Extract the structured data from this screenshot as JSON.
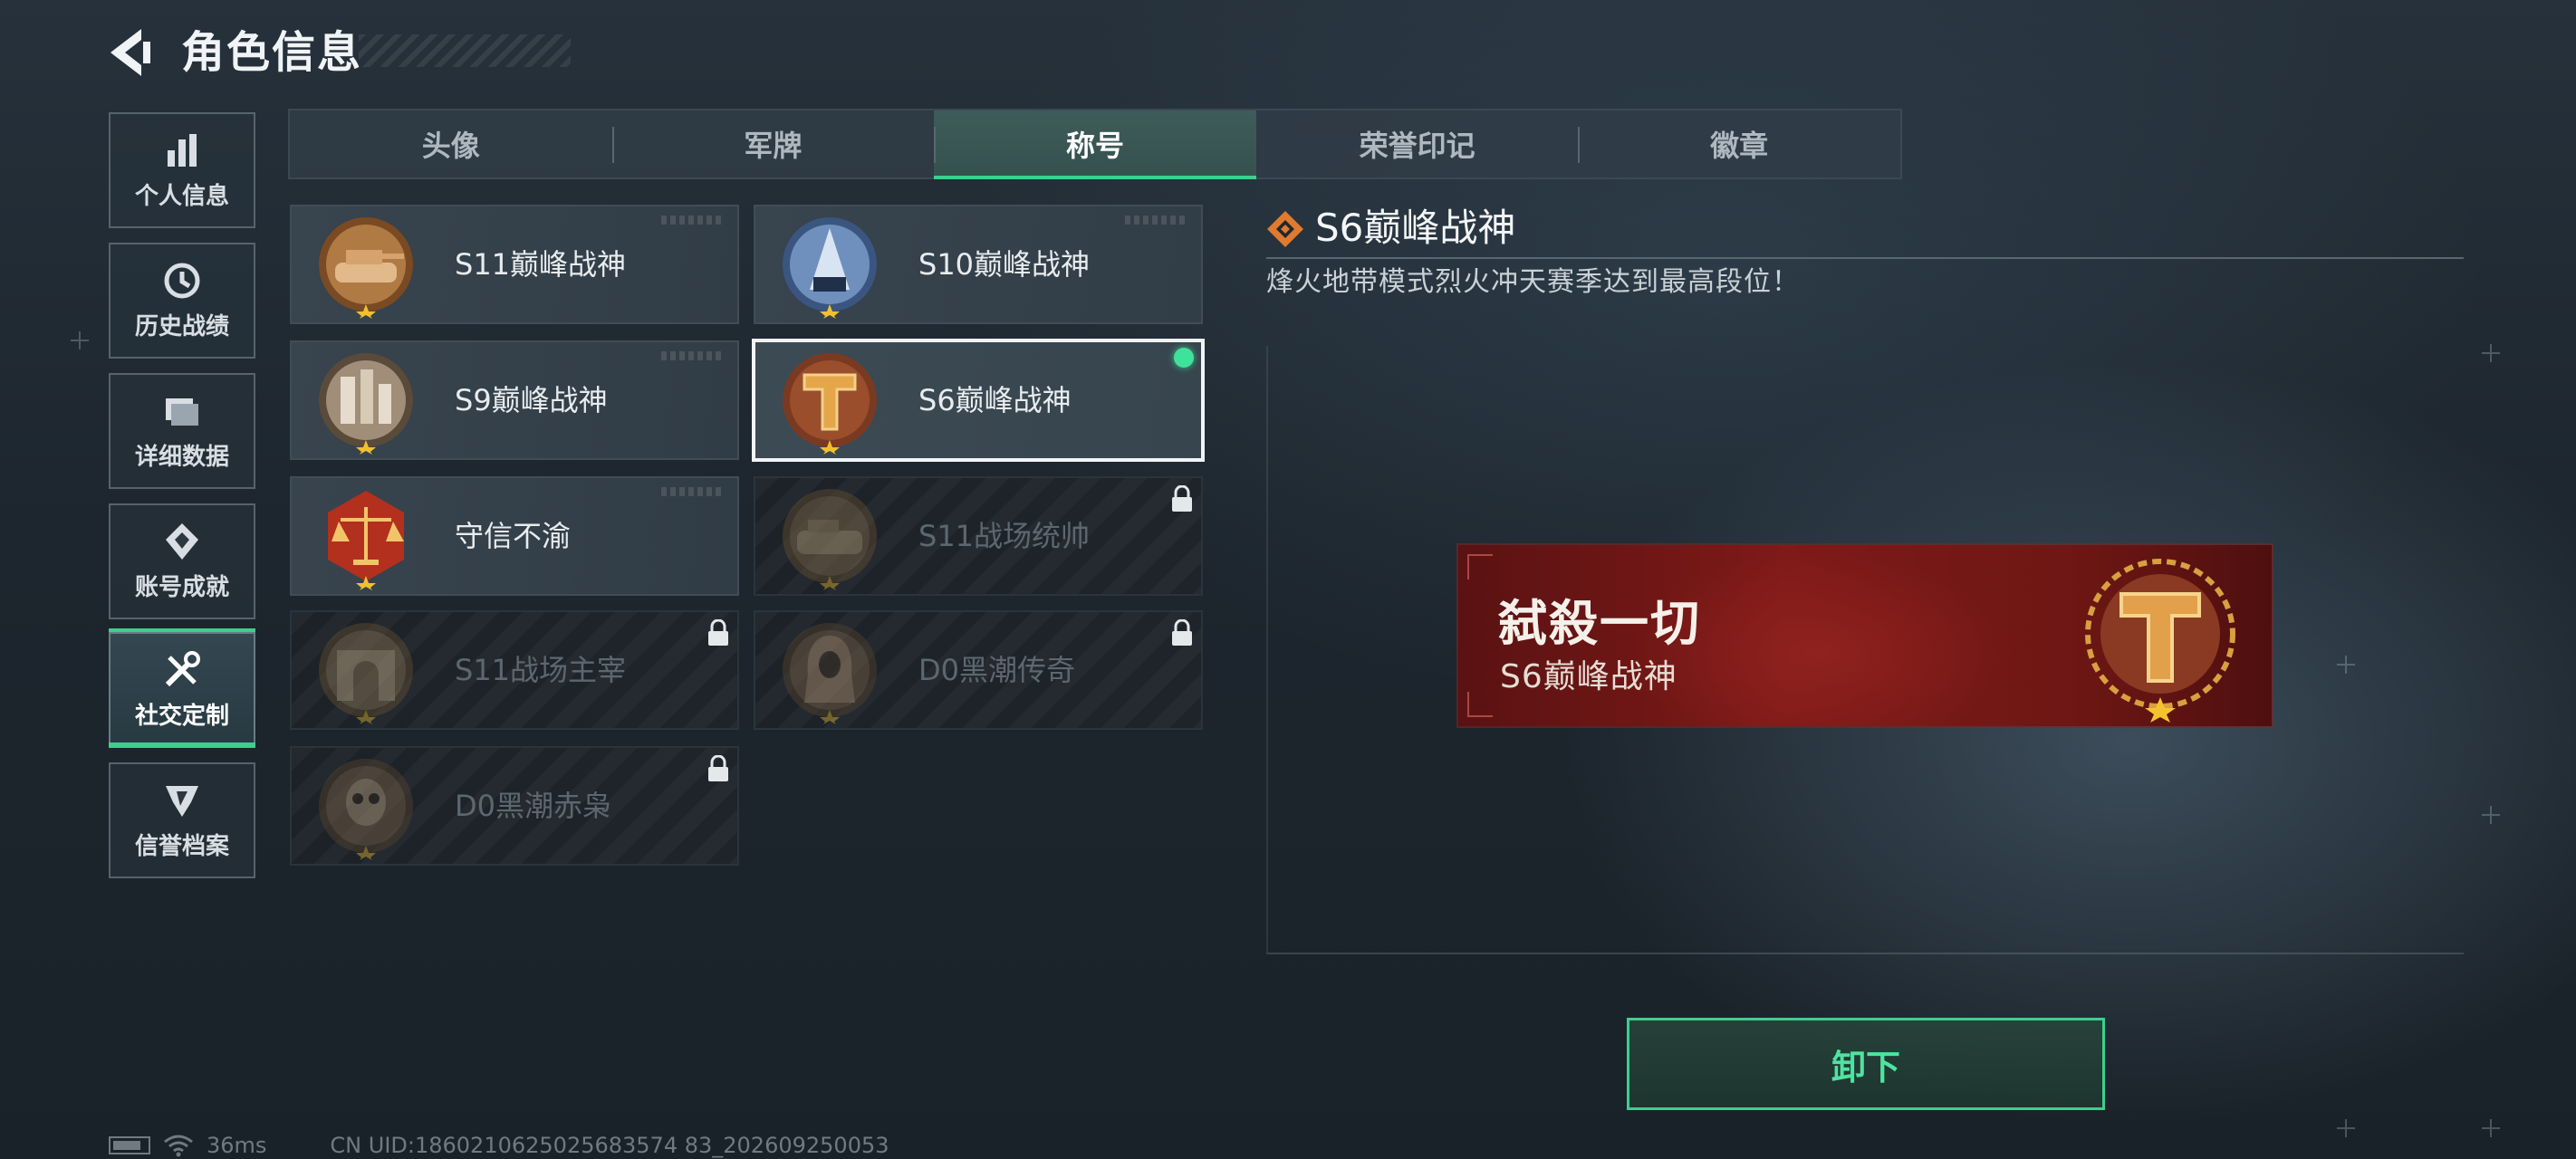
{
  "header": {
    "title": "角色信息"
  },
  "sidebar": {
    "items": [
      {
        "label": "个人信息",
        "icon": "bar-chart-icon",
        "active": false
      },
      {
        "label": "历史战绩",
        "icon": "history-clock-icon",
        "active": false
      },
      {
        "label": "详细数据",
        "icon": "folder-data-icon",
        "active": false
      },
      {
        "label": "账号成就",
        "icon": "achievement-diamond-icon",
        "active": false
      },
      {
        "label": "社交定制",
        "icon": "tools-wrench-icon",
        "active": true
      },
      {
        "label": "信誉档案",
        "icon": "credit-shield-icon",
        "active": false
      }
    ]
  },
  "tabs": [
    {
      "label": "头像",
      "active": false
    },
    {
      "label": "军牌",
      "active": false
    },
    {
      "label": "称号",
      "active": true
    },
    {
      "label": "荣誉印记",
      "active": false
    },
    {
      "label": "徽章",
      "active": false
    }
  ],
  "titles": [
    {
      "label": "S11巅峰战神",
      "medal": "tank-medal-icon",
      "locked": false,
      "selected": false
    },
    {
      "label": "S10巅峰战神",
      "medal": "fortress-medal-icon",
      "locked": false,
      "selected": false
    },
    {
      "label": "S9巅峰战神",
      "medal": "ruins-medal-icon",
      "locked": false,
      "selected": false
    },
    {
      "label": "S6巅峰战神",
      "medal": "t-emblem-medal-icon",
      "locked": false,
      "selected": true
    },
    {
      "label": "守信不渝",
      "medal": "scales-medal-icon",
      "locked": false,
      "selected": false
    },
    {
      "label": "S11战场统帅",
      "medal": "apc-medal-icon",
      "locked": true,
      "selected": false
    },
    {
      "label": "S11战场主宰",
      "medal": "arch-medal-icon",
      "locked": true,
      "selected": false
    },
    {
      "label": "D0黑潮传奇",
      "medal": "hooded-figure-medal-icon",
      "locked": true,
      "selected": false
    },
    {
      "label": "D0黑潮赤枭",
      "medal": "skull-soldier-medal-icon",
      "locked": true,
      "selected": false
    }
  ],
  "detail": {
    "title": "S6巅峰战神",
    "description": "烽火地带模式烈火冲天赛季达到最高段位！",
    "banner": {
      "main_text": "弑殺一切",
      "sub_text": "S6巅峰战神"
    }
  },
  "actions": {
    "unequip_label": "卸下"
  },
  "status_bar": {
    "ping": "36ms",
    "uid": "CN UID:1860210625025683574 83_202609250053"
  },
  "colors": {
    "accent_green": "#3bd08e",
    "banner_red": "#7e1a18",
    "medal_gold": "#c98a2e",
    "detail_icon_orange": "#e07a2e"
  }
}
